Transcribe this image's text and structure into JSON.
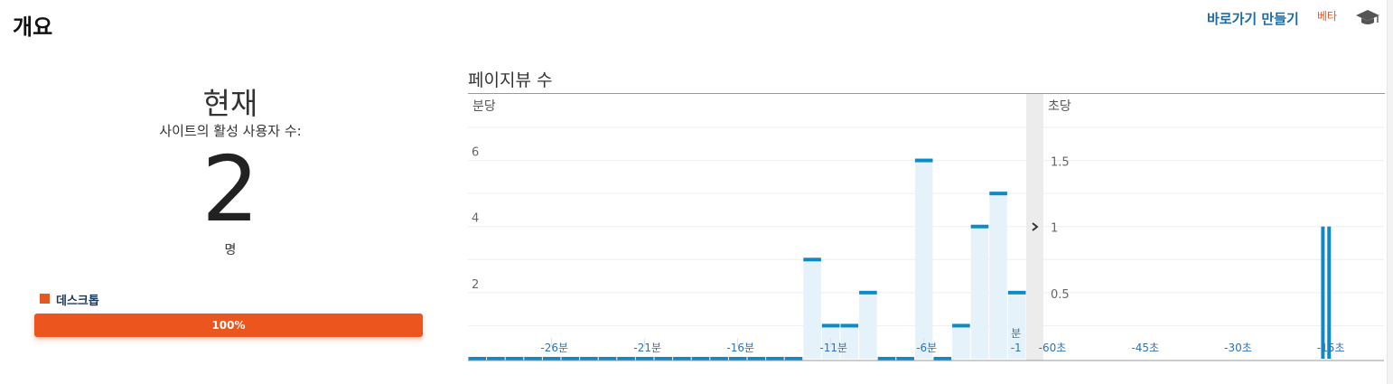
{
  "header": {
    "title": "개요",
    "shortcut_label": "바로가기 만들기",
    "beta_label": "베타",
    "cap_icon": "graduation-cap-icon"
  },
  "realtime": {
    "now_label": "현재",
    "active_users_label": "사이트의 활성 사용자 수:",
    "active_count": "2",
    "unit_label": "명"
  },
  "device": {
    "legend_label": "데스크톱",
    "legend_color": "#e8571f",
    "percent_label": "100%",
    "share": 1.0
  },
  "chart": {
    "title": "페이지뷰 수",
    "expand_icon": "chevron-right-icon"
  },
  "chart_data": [
    {
      "type": "bar",
      "pane_label": "분당",
      "ylim": [
        0,
        7
      ],
      "y_ticks": [
        "2",
        "4",
        "6"
      ],
      "y_tick_values": [
        2,
        4,
        6
      ],
      "x_tick_labels": [
        "-26분",
        "-21분",
        "-16분",
        "-11분",
        "-6분"
      ],
      "x_tick_positions": [
        -26,
        -21,
        -16,
        -11,
        -6
      ],
      "last_tick_label_top": "분",
      "last_tick_label_bottom": "-1",
      "x": [
        -30,
        -29,
        -28,
        -27,
        -26,
        -25,
        -24,
        -23,
        -22,
        -21,
        -20,
        -19,
        -18,
        -17,
        -16,
        -15,
        -14,
        -13,
        -12,
        -11,
        -10,
        -9,
        -8,
        -7,
        -6,
        -5,
        -4,
        -3,
        -2,
        -1
      ],
      "values": [
        0,
        0,
        0,
        0,
        0,
        0,
        0,
        0,
        0,
        0,
        0,
        0,
        0,
        0,
        0,
        0,
        0,
        0,
        3,
        1,
        1,
        2,
        0,
        0,
        6,
        0,
        1,
        4,
        5,
        2
      ],
      "fill_color": "#e6f2f9",
      "line_color": "#0d8ac9"
    },
    {
      "type": "bar",
      "pane_label": "초당",
      "ylim": [
        0,
        1.75
      ],
      "y_ticks": [
        "0.5",
        "1",
        "1.5"
      ],
      "y_tick_values": [
        0.5,
        1,
        1.5
      ],
      "x_tick_labels": [
        "-60초",
        "-45초",
        "-30초",
        "-15초"
      ],
      "x_tick_positions": [
        -60,
        -45,
        -30,
        -15
      ],
      "x": [
        -16,
        -15
      ],
      "values": [
        1,
        1
      ],
      "line_color": "#0d8ac9"
    }
  ]
}
